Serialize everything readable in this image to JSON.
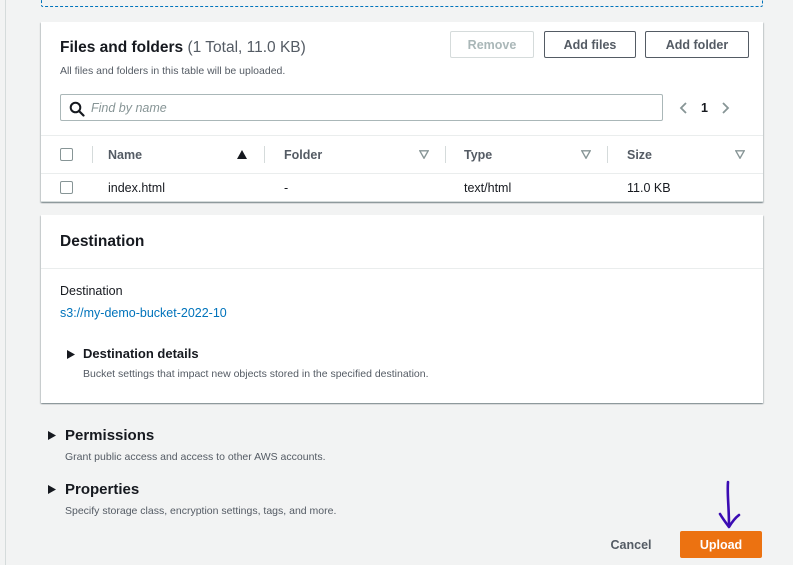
{
  "files": {
    "title": "Files and folders",
    "count": "(1 Total, 11.0 KB)",
    "description": "All files and folders in this table will be uploaded.",
    "remove_label": "Remove",
    "add_files_label": "Add files",
    "add_folder_label": "Add folder",
    "search_placeholder": "Find by name",
    "page": "1",
    "columns": [
      "Name",
      "Folder",
      "Type",
      "Size"
    ],
    "rows": [
      {
        "name": "index.html",
        "folder": "-",
        "type": "text/html",
        "size": "11.0 KB"
      }
    ]
  },
  "destination": {
    "title": "Destination",
    "label": "Destination",
    "link": "s3://my-demo-bucket-2022-10",
    "details_title": "Destination details",
    "details_desc": "Bucket settings that impact new objects stored in the specified destination."
  },
  "permissions": {
    "title": "Permissions",
    "desc": "Grant public access and access to other AWS accounts."
  },
  "properties": {
    "title": "Properties",
    "desc": "Specify storage class, encryption settings, tags, and more."
  },
  "footer": {
    "cancel_label": "Cancel",
    "upload_label": "Upload"
  },
  "colors": {
    "link": "#0073bb",
    "primary_button": "#ec7211",
    "annotation_arrow": "#3b0cb3"
  },
  "icons": {
    "search": "search-icon",
    "prev_page": "chevron-left-icon",
    "next_page": "chevron-right-icon",
    "sort_asc": "sort-ascending-icon",
    "sort": "sort-icon",
    "expand": "caret-right-icon",
    "annotation": "down-arrow-icon"
  }
}
